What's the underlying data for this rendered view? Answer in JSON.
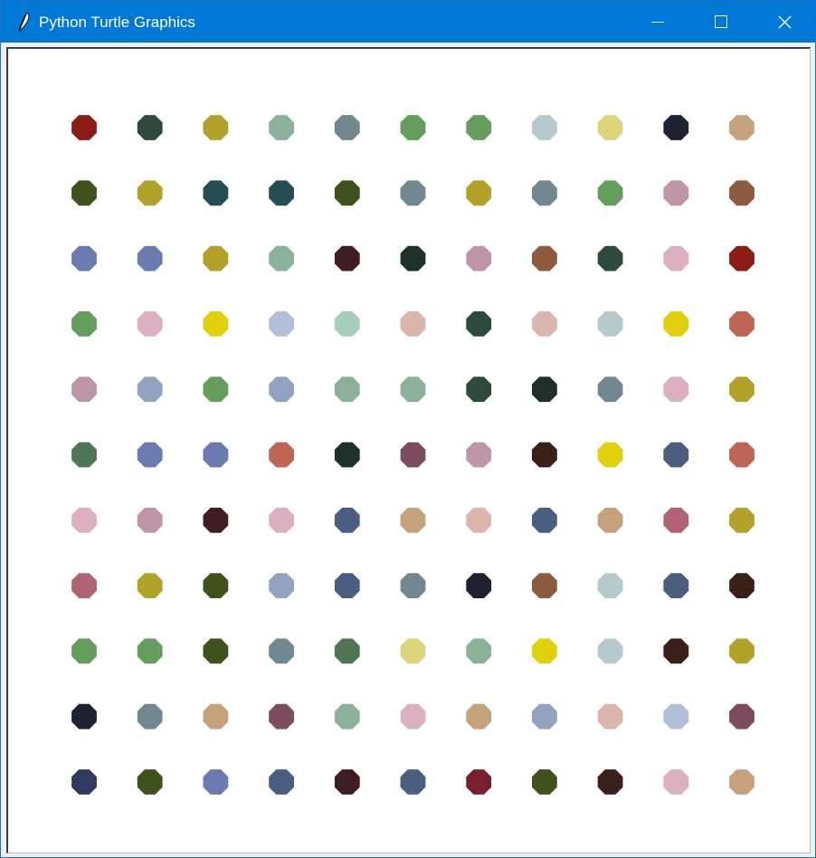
{
  "window": {
    "title": "Python Turtle Graphics",
    "icon": "feather-icon",
    "controls": [
      "minimize-icon",
      "maximize-icon",
      "close-icon"
    ],
    "titlebar_color": "#0078d7"
  },
  "canvas": {
    "background": "#ffffff",
    "dot_rows": [
      [
        "#8b1c15",
        "#2e4a3c",
        "#b3a22a",
        "#8cb19b",
        "#728890",
        "#649d5c",
        "#649d5c",
        "#b6c9cf",
        "#dbd57c",
        "#1e2132",
        "#c6a27c"
      ],
      [
        "#3f521c",
        "#b3a22a",
        "#254d55",
        "#254d55",
        "#3f521c",
        "#728890",
        "#b3a22a",
        "#728890",
        "#649d5c",
        "#be96a8",
        "#8d5a3e"
      ],
      [
        "#6b7bb0",
        "#6b7bb0",
        "#b3a22a",
        "#8cb19b",
        "#401d25",
        "#1f3029",
        "#be96a8",
        "#8d5a3e",
        "#2e4a3c",
        "#dcafc1",
        "#8b1c15"
      ],
      [
        "#649d5c",
        "#dcafc1",
        "#e0d10c",
        "#b3bedb",
        "#a4cfba",
        "#dcb5ac",
        "#2e4a3c",
        "#dcb5ac",
        "#b6c9cf",
        "#e0d10c",
        "#bf6556"
      ],
      [
        "#be96a8",
        "#91a3c1",
        "#649d5c",
        "#91a3c1",
        "#8cb19b",
        "#8cb19b",
        "#2e4a3c",
        "#1f3029",
        "#728890",
        "#dcafc1",
        "#b3a22a"
      ],
      [
        "#4e7653",
        "#6b7bb0",
        "#6b7bb0",
        "#bf6556",
        "#1f3029",
        "#7b4d5e",
        "#be96a8",
        "#3a2019",
        "#e0d10c",
        "#4a5f80",
        "#bf6556"
      ],
      [
        "#dcafc1",
        "#be96a8",
        "#401d25",
        "#dcafc1",
        "#4a5f80",
        "#c6a27c",
        "#dcb5ac",
        "#4a5f80",
        "#c6a27c",
        "#b06473",
        "#b3a22a"
      ],
      [
        "#b06473",
        "#b3a22a",
        "#3f521c",
        "#91a3c1",
        "#4a5f80",
        "#728890",
        "#1e2132",
        "#8d5a3e",
        "#b6c9cf",
        "#4a5f80",
        "#3a2019"
      ],
      [
        "#649d5c",
        "#649d5c",
        "#3f521c",
        "#728890",
        "#4e7653",
        "#dbd57c",
        "#8cb19b",
        "#e0d10c",
        "#b6c9cf",
        "#3a2019",
        "#b3a22a"
      ],
      [
        "#1e2132",
        "#728890",
        "#c6a27c",
        "#7b4d5e",
        "#8cb19b",
        "#dcafc1",
        "#c6a27c",
        "#91a3c1",
        "#dcb5ac",
        "#b3bedb",
        "#7b4d5e"
      ],
      [
        "#2e3a5e",
        "#3f521c",
        "#6b7bb0",
        "#4a5f80",
        "#401d25",
        "#4a5f80",
        "#771f2c",
        "#3f521c",
        "#3a2019",
        "#dcafc1",
        "#c6a27c"
      ]
    ]
  }
}
